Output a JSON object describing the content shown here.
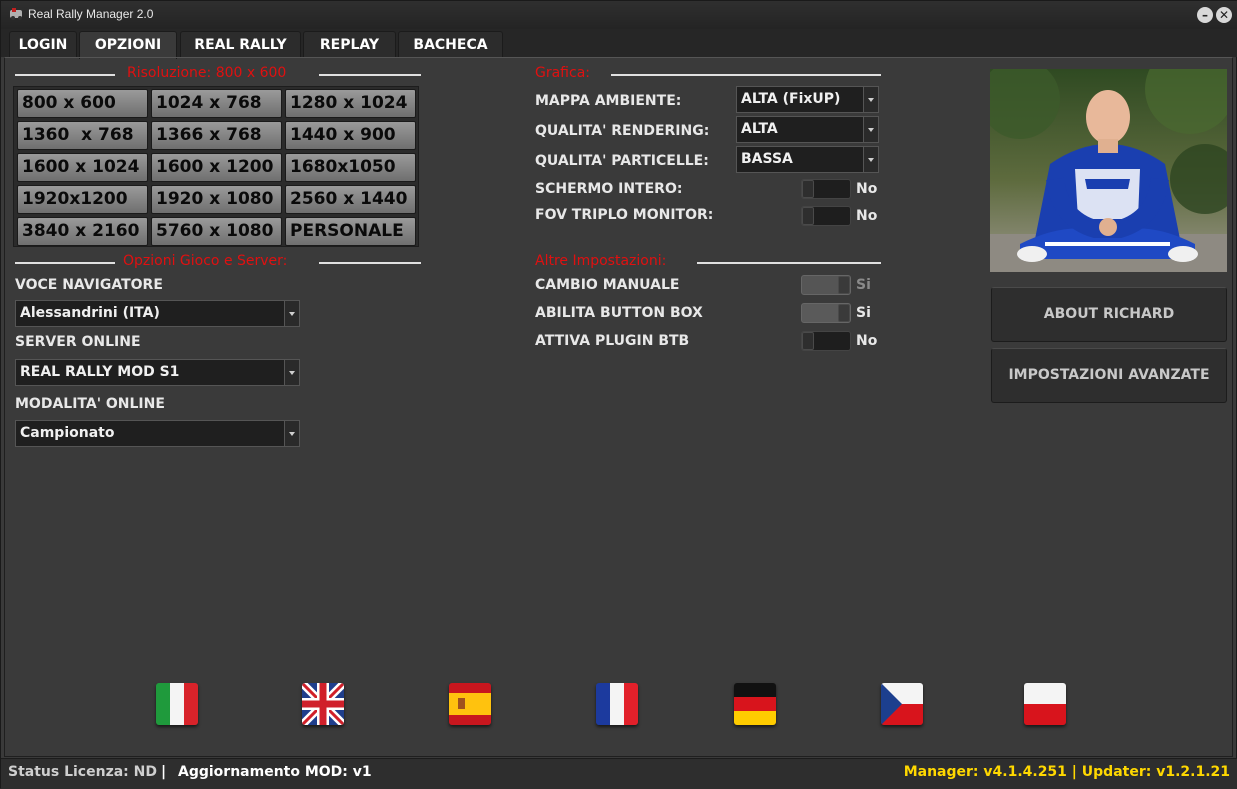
{
  "app": {
    "title": "Real Rally Manager 2.0",
    "minimize": "–",
    "close": "✕"
  },
  "tabs": [
    {
      "label": "LOGIN",
      "active": false
    },
    {
      "label": "OPZIONI",
      "active": true
    },
    {
      "label": "REAL RALLY",
      "active": false
    },
    {
      "label": "REPLAY",
      "active": false
    },
    {
      "label": "BACHECA",
      "active": false
    }
  ],
  "resolution": {
    "title": "Risoluzione: 800 x 600",
    "buttons": [
      "800 x 600",
      "1024 x 768",
      "1280 x 1024",
      "1360  x 768",
      "1366 x 768",
      "1440 x 900",
      "1600 x 1024",
      "1600 x 1200",
      "1680x1050",
      "1920x1200",
      "1920 x 1080",
      "2560 x 1440",
      "3840 x 2160",
      "5760 x 1080",
      "PERSONALE"
    ]
  },
  "game_server": {
    "title": "Opzioni Gioco e Server:",
    "navigator_label": "VOCE NAVIGATORE",
    "navigator_value": "Alessandrini (ITA)",
    "server_label": "SERVER ONLINE",
    "server_value": "REAL RALLY MOD S1",
    "mode_label": "MODALITA' ONLINE",
    "mode_value": "Campionato"
  },
  "graphics": {
    "title": "Grafica:",
    "map_label": "MAPPA AMBIENTE:",
    "map_value": "ALTA (FixUP)",
    "render_label": "QUALITA' RENDERING:",
    "render_value": "ALTA",
    "particles_label": "QUALITA' PARTICELLE:",
    "particles_value": "BASSA",
    "fullscreen_label": "SCHERMO INTERO:",
    "fullscreen_value": "No",
    "fov_label": "FOV TRIPLO MONITOR:",
    "fov_value": "No"
  },
  "other": {
    "title": "Altre Impostazioni:",
    "manual_label": "CAMBIO MANUALE",
    "manual_value": "Si",
    "buttonbox_label": "ABILITA BUTTON BOX",
    "buttonbox_value": "Si",
    "btb_label": "ATTIVA PLUGIN BTB",
    "btb_value": "No"
  },
  "side": {
    "about_button": "ABOUT RICHARD",
    "advanced_button": "IMPOSTAZIONI AVANZATE"
  },
  "flags": [
    "italy-flag-icon",
    "uk-flag-icon",
    "spain-flag-icon",
    "france-flag-icon",
    "germany-flag-icon",
    "czech-flag-icon",
    "poland-flag-icon"
  ],
  "status": {
    "license": "Status Licenza: ND",
    "separator": "|",
    "mod_update": "Aggiornamento MOD: v1",
    "versions": "Manager: v4.1.4.251 | Updater: v1.2.1.21"
  },
  "colors": {
    "section_title": "#e01010",
    "version_text": "#ffd800"
  }
}
